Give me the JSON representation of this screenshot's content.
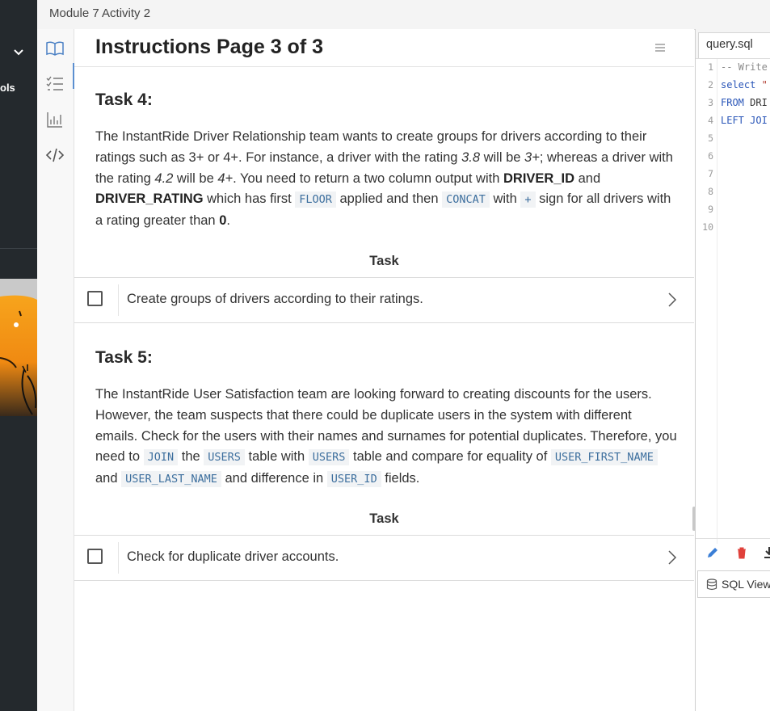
{
  "window": {
    "title": "Module 7 Activity 2"
  },
  "left_strip": {
    "fragment_label": "ols"
  },
  "icon_rail": [
    {
      "name": "book-icon",
      "active": true
    },
    {
      "name": "checklist-icon",
      "active": false
    },
    {
      "name": "bar-chart-icon",
      "active": false
    },
    {
      "name": "code-icon",
      "active": false
    }
  ],
  "instructions": {
    "title": "Instructions Page 3 of 3",
    "task4": {
      "heading": "Task 4:",
      "paragraph": [
        {
          "t": "The InstantRide Driver Relationship team wants to create groups for drivers according to their ratings such as 3+ or 4+. For instance, a driver with the rating "
        },
        {
          "t": "3.8",
          "s": "i"
        },
        {
          "t": " will be "
        },
        {
          "t": "3+",
          "s": "i"
        },
        {
          "t": "; whereas a driver with the rating "
        },
        {
          "t": "4.2",
          "s": "i"
        },
        {
          "t": " will be "
        },
        {
          "t": "4+",
          "s": "i"
        },
        {
          "t": ". You need to return a two column output with "
        },
        {
          "t": "DRIVER_ID",
          "s": "b"
        },
        {
          "t": " and "
        },
        {
          "t": "DRIVER_RATING",
          "s": "b"
        },
        {
          "t": " which has first "
        },
        {
          "t": "FLOOR",
          "s": "code"
        },
        {
          "t": " applied and then "
        },
        {
          "t": "CONCAT",
          "s": "code"
        },
        {
          "t": " with "
        },
        {
          "t": "+",
          "s": "code"
        },
        {
          "t": " sign for all drivers with a rating greater than "
        },
        {
          "t": "0",
          "s": "b"
        },
        {
          "t": "."
        }
      ],
      "task_label": "Task",
      "task_item": "Create groups of drivers according to their ratings."
    },
    "task5": {
      "heading": "Task 5:",
      "paragraph": [
        {
          "t": "The InstantRide User Satisfaction team are looking forward to creating discounts for the users. However, the team suspects that there could be duplicate users in the system with different emails. Check for the users with their names and surnames for potential duplicates. Therefore, you need to "
        },
        {
          "t": "JOIN",
          "s": "code"
        },
        {
          "t": " the "
        },
        {
          "t": "USERS",
          "s": "code"
        },
        {
          "t": " table with "
        },
        {
          "t": "USERS",
          "s": "code"
        },
        {
          "t": " table and compare for equality of "
        },
        {
          "t": "USER_FIRST_NAME",
          "s": "code"
        },
        {
          "t": " and "
        },
        {
          "t": "USER_LAST_NAME",
          "s": "code"
        },
        {
          "t": " and difference in "
        },
        {
          "t": "USER_ID",
          "s": "code"
        },
        {
          "t": " fields."
        }
      ],
      "task_label": "Task",
      "task_item": "Check for duplicate driver accounts."
    }
  },
  "editor": {
    "tab_name": "query.sql",
    "line_numbers": [
      "1",
      "2",
      "3",
      "4",
      "5",
      "6",
      "7",
      "8",
      "9",
      "10"
    ],
    "code_lines": [
      [
        {
          "t": "-- Write",
          "c": "comment"
        }
      ],
      [
        {
          "t": "select ",
          "c": "kw"
        },
        {
          "t": "\"",
          "c": "str"
        }
      ],
      [
        {
          "t": "FROM ",
          "c": "kw"
        },
        {
          "t": "DRI",
          "c": "plain"
        }
      ],
      [
        {
          "t": "LEFT JOI",
          "c": "kw"
        }
      ]
    ],
    "toolbar_icons": [
      "pencil-icon",
      "trash-icon",
      "download-icon"
    ],
    "sql_view_label": "SQL View",
    "colors": {
      "keyword": "#2a56b8",
      "comment": "#8a8a8a",
      "string": "#b03a2e",
      "pencil": "#3b7fd6",
      "trash": "#e0413b"
    }
  }
}
